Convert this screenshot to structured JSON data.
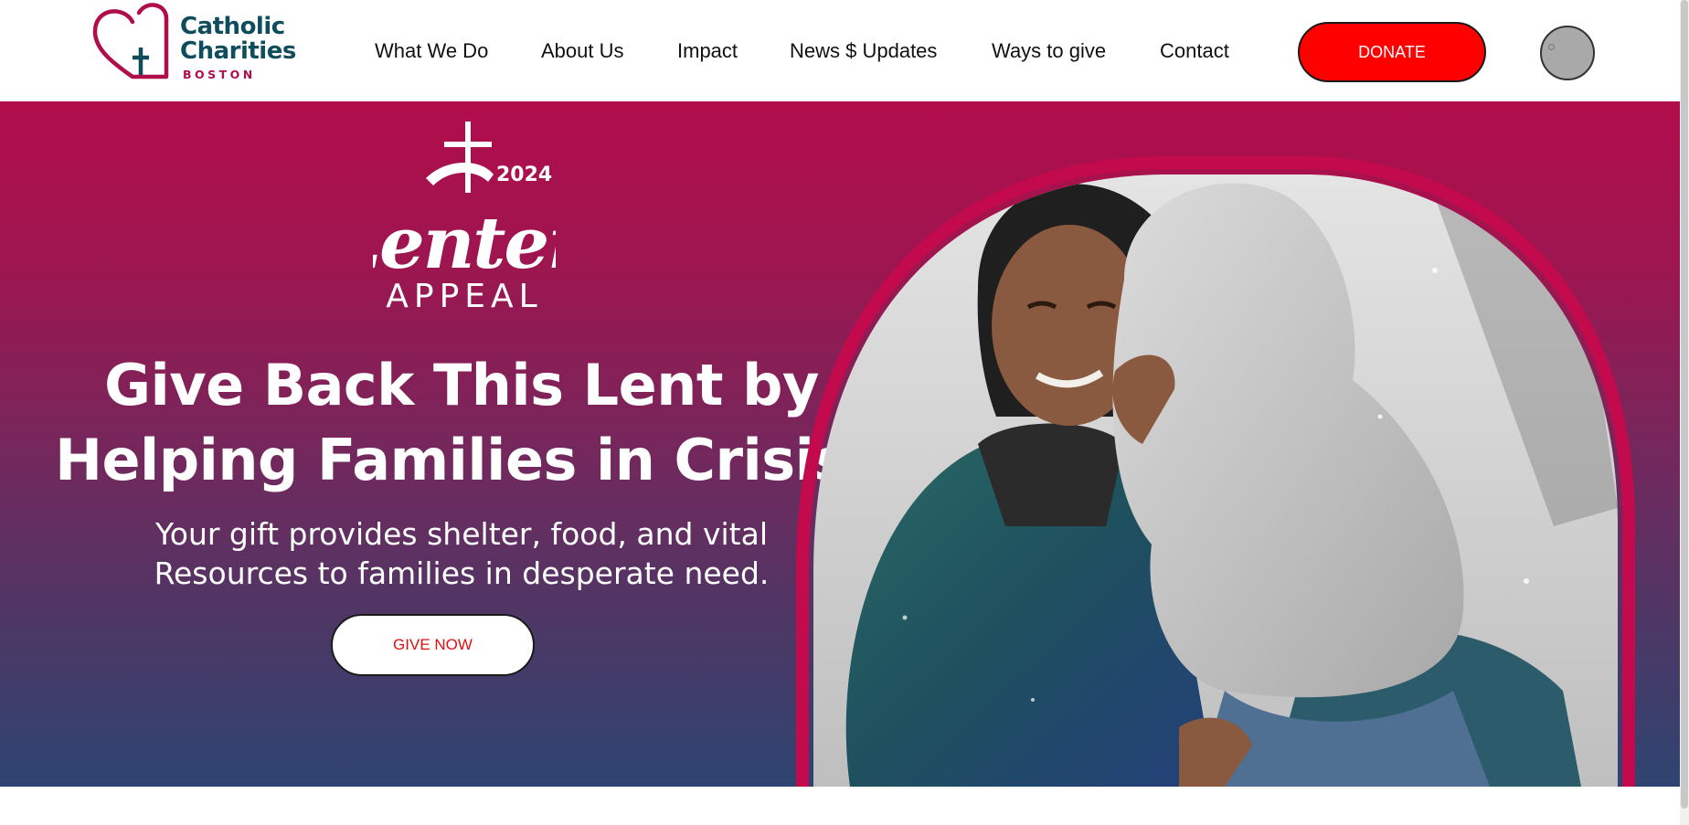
{
  "brand": {
    "line1": "Catholic",
    "line2": "Charities",
    "sub": "BOSTON",
    "colors": {
      "teal": "#0f4d5c",
      "crimson": "#b00d4b"
    }
  },
  "nav": {
    "items": [
      {
        "label": "What We Do"
      },
      {
        "label": "About Us"
      },
      {
        "label": "Impact"
      },
      {
        "label": "News $ Updates"
      },
      {
        "label": "Ways to give"
      },
      {
        "label": "Contact"
      }
    ],
    "donate_label": "DONATE",
    "donate_color": "#ff0000",
    "account_icon": "account-avatar-icon"
  },
  "hero": {
    "badge_year": "2024",
    "badge_script": "Lenten",
    "badge_caption": "APPEAL",
    "headline_line1": "Give Back This Lent by",
    "headline_line2": "Helping Families in Crisis.",
    "sub_line1": "Your gift provides shelter, food, and vital",
    "sub_line2": "Resources to families in desperate need.",
    "cta_label": "GIVE NOW",
    "gradient_top": "#b20d4b",
    "gradient_bottom": "#2e4470"
  }
}
